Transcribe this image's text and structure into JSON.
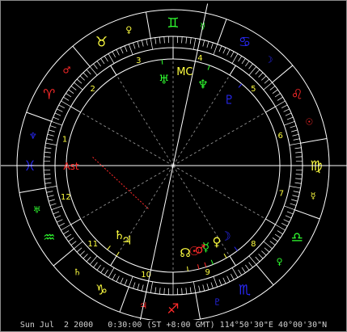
{
  "colors": {
    "background": "#000000",
    "ring": "#ffffff",
    "aspect": "#9a9a9a",
    "fire": "#ff2a2a",
    "earth": "#ffff40",
    "air": "#30ff30",
    "water": "#2a2aff",
    "house_number": "#ffff40"
  },
  "zodiac": [
    {
      "sign": "aries",
      "glyph": "♈",
      "ruler": "♂",
      "element": "fire"
    },
    {
      "sign": "taurus",
      "glyph": "♉",
      "ruler": "♀",
      "element": "earth"
    },
    {
      "sign": "gemini",
      "glyph": "♊",
      "ruler": "☿",
      "element": "air"
    },
    {
      "sign": "cancer",
      "glyph": "♋",
      "ruler": "☽",
      "element": "water"
    },
    {
      "sign": "leo",
      "glyph": "♌",
      "ruler": "☉",
      "element": "fire"
    },
    {
      "sign": "virgo",
      "glyph": "♍",
      "ruler": "☿",
      "element": "earth"
    },
    {
      "sign": "libra",
      "glyph": "♎",
      "ruler": "♀",
      "element": "air"
    },
    {
      "sign": "scorpio",
      "glyph": "♏",
      "ruler": "♇",
      "element": "water"
    },
    {
      "sign": "sagittarius",
      "glyph": "♐",
      "ruler": "♃",
      "element": "fire"
    },
    {
      "sign": "capricorn",
      "glyph": "♑",
      "ruler": "♄",
      "element": "earth"
    },
    {
      "sign": "aquarius",
      "glyph": "♒",
      "ruler": "♅",
      "element": "air"
    },
    {
      "sign": "pisces",
      "glyph": "♓",
      "ruler": "♆",
      "element": "water"
    }
  ],
  "houses": [
    "1",
    "2",
    "3",
    "4",
    "5",
    "6",
    "7",
    "8",
    "9",
    "10",
    "11",
    "12"
  ],
  "planets": [
    {
      "name": "sun",
      "glyph": "☉",
      "element": "fire"
    },
    {
      "name": "moon",
      "glyph": "☽",
      "element": "water"
    },
    {
      "name": "mercury",
      "glyph": "☿",
      "element": "air"
    },
    {
      "name": "venus",
      "glyph": "♀",
      "element": "earth"
    },
    {
      "name": "mars",
      "glyph": "♂",
      "element": "fire"
    },
    {
      "name": "jupiter",
      "glyph": "♃",
      "element": "earth"
    },
    {
      "name": "saturn",
      "glyph": "♄",
      "element": "earth"
    },
    {
      "name": "uranus",
      "glyph": "♅",
      "element": "air"
    },
    {
      "name": "neptune",
      "glyph": "♆",
      "element": "air"
    },
    {
      "name": "pluto",
      "glyph": "♇",
      "element": "water"
    },
    {
      "name": "node",
      "glyph": "☊",
      "element": "earth"
    }
  ],
  "angles": {
    "ascendant_label": "Ast",
    "midheaven_label": "MC"
  },
  "status": "Sun Jul  2 2000   0:30:00 (ST +8:00 GMT) 114°50'30\"E 40°00'30\"N"
}
